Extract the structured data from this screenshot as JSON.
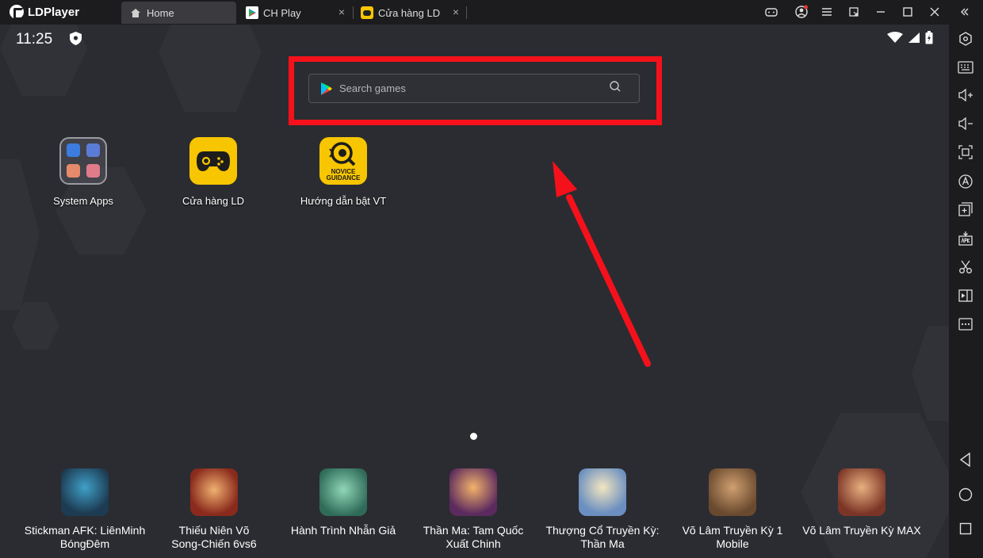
{
  "titlebar": {
    "app_name": "LDPlayer",
    "tabs": [
      {
        "label": "Home",
        "active": true
      },
      {
        "label": "CH Play",
        "active": false
      },
      {
        "label": "Cửa hàng LD",
        "active": false
      }
    ],
    "close_glyph": "×"
  },
  "status": {
    "time": "11:25"
  },
  "search": {
    "placeholder": "Search games"
  },
  "apps": [
    {
      "label": "System Apps",
      "icon": "system-apps-folder-icon"
    },
    {
      "label": "Cửa hàng LD",
      "icon": "gamepad-icon"
    },
    {
      "label": "Hướng dẫn bật VT",
      "icon": "novice-guidance-icon",
      "badge_text": "NOVICE GUIDANCE"
    }
  ],
  "dock": [
    {
      "line1": "Stickman AFK: LiênMinh",
      "line2": "BóngĐêm",
      "color": "#1d3b52"
    },
    {
      "line1": "Thiếu Niên Võ",
      "line2": "Song-Chiến 6vs6",
      "color": "#8a2a1c"
    },
    {
      "line1": "Hành Trình Nhẫn Giả",
      "line2": "",
      "color": "#2f6b58"
    },
    {
      "line1": "Thần Ma: Tam Quốc",
      "line2": "Xuất Chinh",
      "color": "#5b2a5e"
    },
    {
      "line1": "Thượng Cổ Truyền Kỳ:",
      "line2": "Thần Ma",
      "color": "#6b8fc0"
    },
    {
      "line1": "Võ Lâm Truyền Kỳ 1",
      "line2": "Mobile",
      "color": "#6a4a2f"
    },
    {
      "line1": "Võ Lâm Truyền Kỳ MAX",
      "line2": "",
      "color": "#7b3526"
    }
  ],
  "colors": {
    "highlight": "#f5111b",
    "accent_yellow": "#f7c600"
  }
}
